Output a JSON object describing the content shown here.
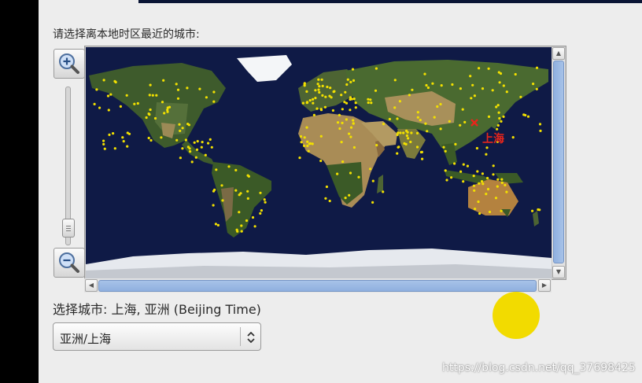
{
  "heading": "请选择离本地时区最近的城市:",
  "map": {
    "selected_city_label": "上海",
    "selected_marker": "x-marker-icon"
  },
  "zoom": {
    "in_icon": "zoom-in-icon",
    "out_icon": "zoom-out-icon"
  },
  "selected": {
    "label": "选择城市: 上海,  亚洲 (Beijing Time)"
  },
  "timezone_select": {
    "value": "亚洲/上海",
    "icon": "updown-chevron-icon"
  },
  "watermark": "https://blog.csdn.net/qq_37698425",
  "colors": {
    "ocean": "#0f1a46",
    "city_dot": "#f2e000",
    "selected_city": "#e8251b",
    "scroll_thumb": "#9bb9e4",
    "cursor_highlight": "#f2db00"
  }
}
